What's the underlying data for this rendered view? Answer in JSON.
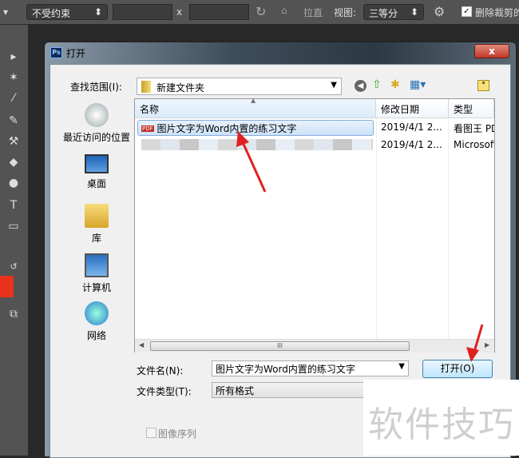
{
  "options_bar": {
    "constraint": "不受约束",
    "x_sep": "x",
    "straighten": "拉直",
    "view_label": "视图:",
    "view_value": "三等分",
    "delete_cropped": "删除裁剪的"
  },
  "dialog": {
    "title": "打开",
    "close": "x",
    "look_in_label": "查找范围(I):",
    "look_in_value": "新建文件夹",
    "places": [
      {
        "label": "最近访问的位置"
      },
      {
        "label": "桌面"
      },
      {
        "label": "库"
      },
      {
        "label": "计算机"
      },
      {
        "label": "网络"
      }
    ],
    "columns": [
      "名称",
      "修改日期",
      "类型"
    ],
    "files": [
      {
        "name": "图片文字为Word内置的练习文字",
        "date": "2019/4/1 2...",
        "type": "看图王 PDF"
      },
      {
        "name": "",
        "date": "2019/4/1 2...",
        "type": "Microsoft"
      }
    ],
    "scroll_grip": "III",
    "filename_label": "文件名(N):",
    "filename_value": "图片文字为Word内置的练习文字",
    "filetype_label": "文件类型(T):",
    "filetype_value": "所有格式",
    "open_button": "打开(O)",
    "image_sequence": "图像序列"
  },
  "watermark": "软件技巧",
  "colors": {
    "foreground": "#e8321c",
    "accent": "#3c7fb1",
    "arrow": "#e02020"
  }
}
